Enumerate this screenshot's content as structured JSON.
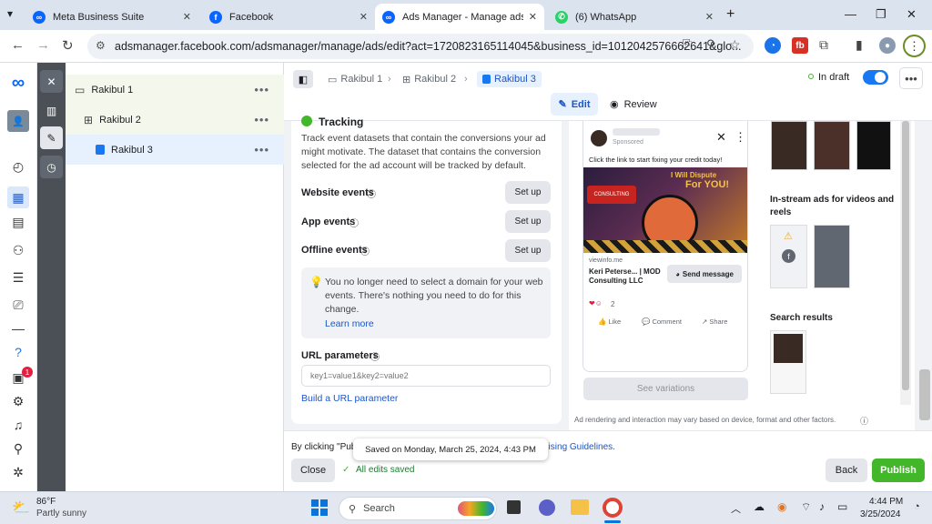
{
  "browser": {
    "tabs": [
      {
        "title": "Meta Business Suite",
        "icon": "meta-icon"
      },
      {
        "title": "Facebook",
        "icon": "facebook-icon"
      },
      {
        "title": "Ads Manager - Manage ads - A",
        "icon": "meta-icon"
      },
      {
        "title": "(6) WhatsApp",
        "icon": "whatsapp-icon"
      }
    ],
    "url": "adsmanager.facebook.com/adsmanager/manage/ads/edit?act=1720823165114045&business_id=1012042576662641&glo..."
  },
  "rail": {
    "notification_count": "1"
  },
  "tree": {
    "campaign": "Rakibul 1",
    "adset": "Rakibul 2",
    "ad": "Rakibul 3"
  },
  "header": {
    "breadcrumb": [
      "Rakibul 1",
      "Rakibul 2",
      "Rakibul 3"
    ],
    "status": "In draft",
    "edit_label": "Edit",
    "review_label": "Review"
  },
  "tracking": {
    "title": "Tracking",
    "description": "Track event datasets that contain the conversions your ad might motivate. The dataset that contains the conversion selected for the ad account will be tracked by default.",
    "events": [
      {
        "label": "Website events",
        "button": "Set up"
      },
      {
        "label": "App events",
        "button": "Set up"
      },
      {
        "label": "Offline events",
        "button": "Set up"
      }
    ],
    "tip": "You no longer need to select a domain for your web events. There's nothing you need to do for this change.",
    "tip_link": "Learn more",
    "url_params_label": "URL parameters",
    "url_params_placeholder": "key1=value1&key2=value2",
    "build_link": "Build a URL parameter"
  },
  "preview": {
    "sponsored": "Sponsored",
    "caption": "Click the link to start fixing your credit today!",
    "creative_text1": "I Will Dispute",
    "creative_text2": "For YOU!",
    "creative_badge": "CONSULTING",
    "domain": "viewinfo.me",
    "headline": "Keri Peterse... | MOD Consulting LLC",
    "cta": "Send message",
    "reactions": "2",
    "actions": [
      "Like",
      "Comment",
      "Share"
    ],
    "see_variations": "See variations",
    "instream_title": "In-stream ads for videos and reels",
    "search_title": "Search results",
    "disclaimer": "Ad rendering and interaction may vary based on device, format and other factors."
  },
  "footer": {
    "by_clicking": "By clicking \"Pub",
    "guidelines_tail": "dising Guidelines.",
    "tooltip": "Saved on Monday, March 25, 2024, 4:43 PM",
    "close": "Close",
    "saved": "All edits saved",
    "back": "Back",
    "publish": "Publish"
  },
  "taskbar": {
    "weather_temp": "86°F",
    "weather_desc": "Partly sunny",
    "search": "Search",
    "time": "4:44 PM",
    "date": "3/25/2024"
  },
  "colors": {
    "meta_blue": "#0866ff",
    "publish_green": "#42b72a",
    "tree_selected": "#e7f3ff",
    "tree_highlight": "#f4f8ea"
  }
}
